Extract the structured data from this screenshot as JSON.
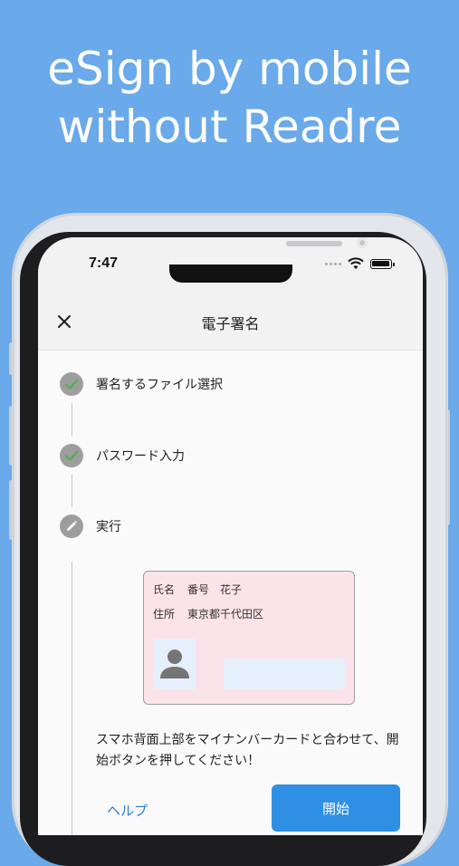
{
  "headline": {
    "line1": "eSign by mobile",
    "line2": "without Readre"
  },
  "status_bar": {
    "time": "7:47",
    "icons": [
      "signal-dots-icon",
      "wifi-icon",
      "battery-icon"
    ]
  },
  "navbar": {
    "close_icon": "close-icon",
    "title": "電子署名"
  },
  "steps": [
    {
      "label": "署名するファイル選択",
      "state": "done",
      "icon": "check-icon"
    },
    {
      "label": "パスワード入力",
      "state": "done",
      "icon": "check-icon"
    },
    {
      "label": "実行",
      "state": "active",
      "icon": "pencil-icon"
    }
  ],
  "card": {
    "name_label": "氏名",
    "name_value": "番号　花子",
    "address_label": "住所",
    "address_value": "東京都千代田区",
    "photo_icon": "person-icon"
  },
  "instruction": "スマホ背面上部をマイナンバーカードと合わせて、開始ボタンを押してください！",
  "actions": {
    "help_label": "ヘルプ",
    "start_label": "開始"
  },
  "colors": {
    "background": "#6aa9ea",
    "accent": "#2f8fe3",
    "link": "#2f7fd6",
    "card_bg": "#fbe4e9",
    "step_circle": "#9e9e9e",
    "check": "#4caf50"
  }
}
